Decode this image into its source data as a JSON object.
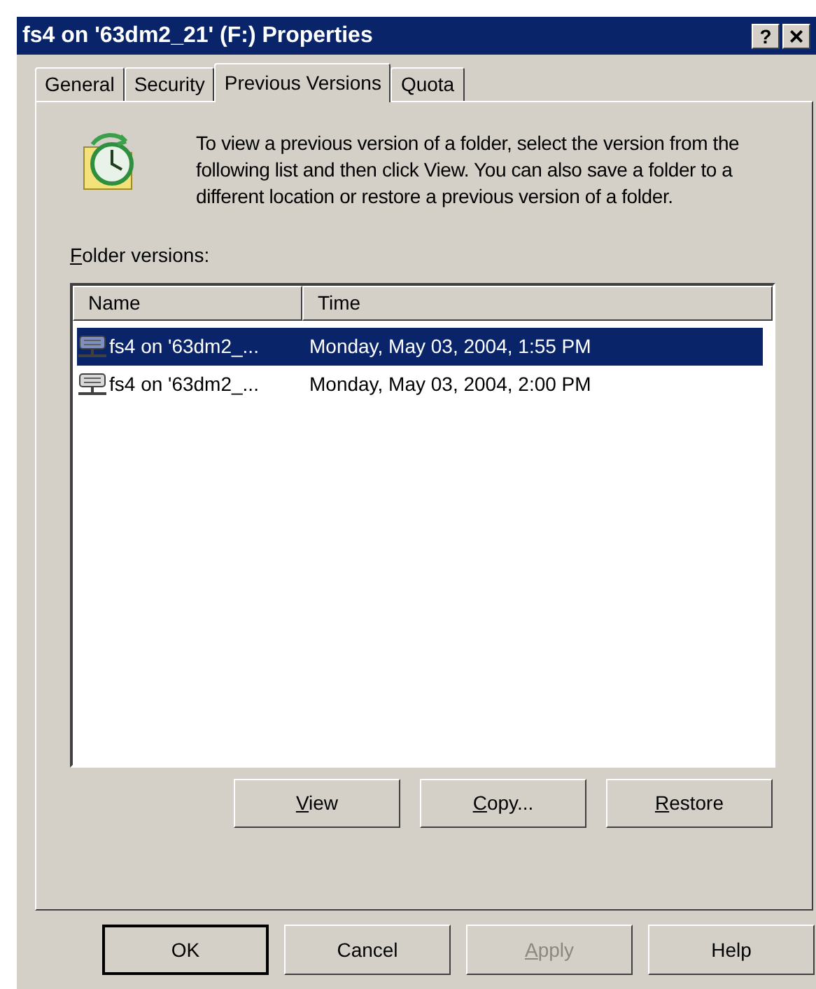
{
  "window": {
    "title": "fs4 on '63dm2_21' (F:) Properties",
    "controls": [
      {
        "kind": "help",
        "label": "?"
      },
      {
        "kind": "close",
        "label": "×"
      }
    ]
  },
  "tabs": [
    {
      "label": "General",
      "selected": false
    },
    {
      "label": "Security",
      "selected": false
    },
    {
      "label": "Previous Versions",
      "selected": true
    },
    {
      "label": "Quota",
      "selected": false
    }
  ],
  "description": "To view a previous version of a folder, select the version from the following list and then click View. You can also save a folder to a different location or restore a previous version of a folder.",
  "list_label": {
    "text": "Folder versions:",
    "mnemonic": true
  },
  "table": {
    "columns": [
      "Name",
      "Time"
    ],
    "rows": [
      {
        "name": "fs4 on '63dm2_...",
        "time": "Monday, May 03, 2004, 1:55 PM",
        "selected": true
      },
      {
        "name": "fs4 on '63dm2_...",
        "time": "Monday, May 03, 2004, 2:00 PM",
        "selected": false
      }
    ]
  },
  "actions": [
    {
      "label": "View",
      "mnemonic": true
    },
    {
      "label": "Copy...",
      "mnemonic": true
    },
    {
      "label": "Restore",
      "mnemonic": true
    }
  ],
  "buttons": [
    {
      "label": "OK",
      "default": true,
      "disabled": false,
      "mnemonic": false
    },
    {
      "label": "Cancel",
      "default": false,
      "disabled": false,
      "mnemonic": false
    },
    {
      "label": "Apply",
      "default": false,
      "disabled": true,
      "mnemonic": true
    },
    {
      "label": "Help",
      "default": false,
      "disabled": false,
      "mnemonic": false
    }
  ]
}
